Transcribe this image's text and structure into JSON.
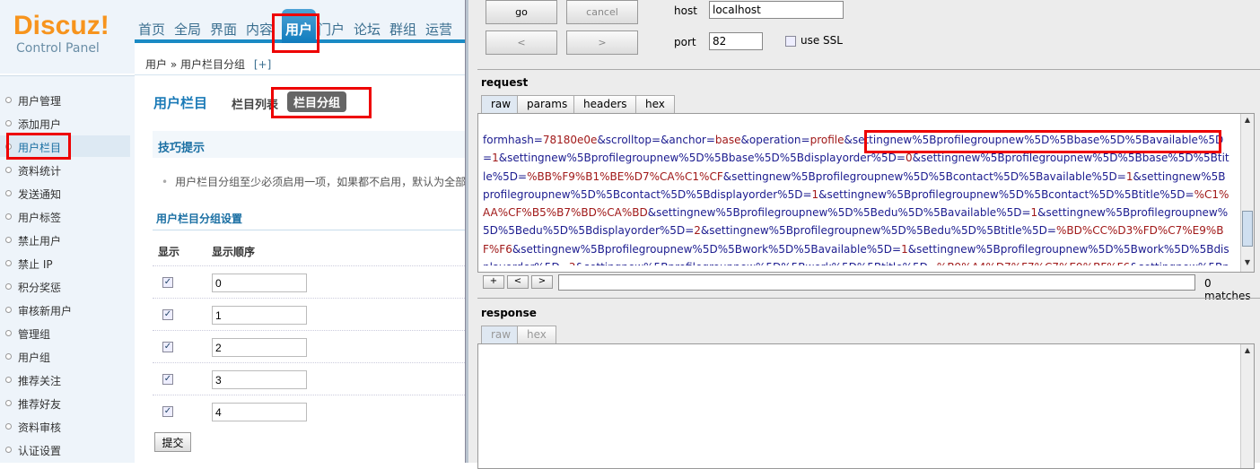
{
  "left": {
    "logo": {
      "brand": "Discuz!",
      "sub": "Control Panel"
    },
    "nav": [
      "首页",
      "全局",
      "界面",
      "内容",
      "用户",
      "门户",
      "论坛",
      "群组",
      "运营"
    ],
    "nav_active": "用户",
    "breadcrumb": {
      "root": "用户",
      "sep": "»",
      "current": "用户栏目分组",
      "add": "[+]"
    },
    "sidebar": [
      "用户管理",
      "添加用户",
      "用户栏目",
      "资料统计",
      "发送通知",
      "用户标签",
      "禁止用户",
      "禁止 IP",
      "积分奖惩",
      "审核新用户",
      "管理组",
      "用户组",
      "推荐关注",
      "推荐好友",
      "资料审核",
      "认证设置"
    ],
    "sidebar_active": "用户栏目",
    "title": "用户栏目",
    "tabs": [
      "栏目列表",
      "栏目分组"
    ],
    "tips_title": "技巧提示",
    "tip": "用户栏目分组至少必须启用一项，如果都不启用，默认为全部启用",
    "settings_title": "用户栏目分组设置",
    "columns": [
      "显示",
      "显示顺序"
    ],
    "rows": [
      {
        "checked": true,
        "order": "0"
      },
      {
        "checked": true,
        "order": "1"
      },
      {
        "checked": true,
        "order": "2"
      },
      {
        "checked": true,
        "order": "3"
      },
      {
        "checked": true,
        "order": "4"
      }
    ],
    "submit": "提交"
  },
  "right": {
    "go": "go",
    "cancel": "cancel",
    "prev": "<",
    "next": ">",
    "host_label": "host",
    "host": "localhost",
    "port_label": "port",
    "port": "82",
    "ssl_label": "use SSL",
    "ssl": false,
    "request_label": "request",
    "request_tabs": [
      "raw",
      "params",
      "headers",
      "hex"
    ],
    "request_params": [
      [
        "formhash",
        "78180e0e"
      ],
      [
        "scrolltop",
        ""
      ],
      [
        "anchor",
        "base"
      ],
      [
        "operation",
        "profile"
      ],
      [
        "settingnew%5Bprofilegroupnew%5D%5Bbase%5D%5Bavailable%5D",
        "1"
      ],
      [
        "settingnew%5Bprofilegroupnew%5D%5Bbase%5D%5Bdisplayorder%5D",
        "0"
      ],
      [
        "settingnew%5Bprofilegroupnew%5D%5Bbase%5D%5Btitle%5D",
        "%BB%F9%B1%BE%D7%CA%C1%CF"
      ],
      [
        "settingnew%5Bprofilegroupnew%5D%5Bcontact%5D%5Bavailable%5D",
        "1"
      ],
      [
        "settingnew%5Bprofilegroupnew%5D%5Bcontact%5D%5Bdisplayorder%5D",
        "1"
      ],
      [
        "settingnew%5Bprofilegroupnew%5D%5Bcontact%5D%5Btitle%5D",
        "%C1%AA%CF%B5%B7%BD%CA%BD"
      ],
      [
        "settingnew%5Bprofilegroupnew%5D%5Bedu%5D%5Bavailable%5D",
        "1"
      ],
      [
        "settingnew%5Bprofilegroupnew%5D%5Bedu%5D%5Bdisplayorder%5D",
        "2"
      ],
      [
        "settingnew%5Bprofilegroupnew%5D%5Bedu%5D%5Btitle%5D",
        "%BD%CC%D3%FD%C7%E9%BF%F6"
      ],
      [
        "settingnew%5Bprofilegroupnew%5D%5Bwork%5D%5Bavailable%5D",
        "1"
      ],
      [
        "settingnew%5Bprofilegroupnew%5D%5Bwork%5D%5Bdisplayorder%5D",
        "3"
      ],
      [
        "settingnew%5Bprofilegroupnew%5D%5Bwork%5D%5Btitle%5D",
        "%B9%A4%D7%F7%C7%E9%BF%F6"
      ],
      [
        "settingnew%5Bprofilegroupnew%5D%5Binfo%5D%5Bavailable%5D",
        "1"
      ],
      [
        "settingnew%5Bprofilegroupnew%5D%5Binfo",
        ""
      ]
    ],
    "search_buttons": [
      "+",
      "<",
      ">"
    ],
    "search_value": "",
    "matches": "0 matches",
    "response_label": "response",
    "response_tabs": [
      "raw",
      "hex"
    ],
    "colors": {
      "key": "#1b1b8f",
      "value": "#a01818",
      "highlight": "#e00000"
    }
  }
}
